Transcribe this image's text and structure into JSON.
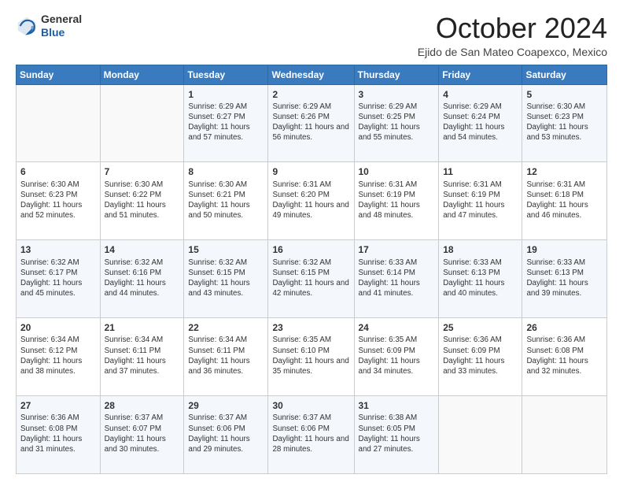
{
  "header": {
    "logo": {
      "line1": "General",
      "line2": "Blue"
    },
    "title": "October 2024",
    "location": "Ejido de San Mateo Coapexco, Mexico"
  },
  "weekdays": [
    "Sunday",
    "Monday",
    "Tuesday",
    "Wednesday",
    "Thursday",
    "Friday",
    "Saturday"
  ],
  "weeks": [
    [
      {
        "day": "",
        "sunrise": "",
        "sunset": "",
        "daylight": ""
      },
      {
        "day": "",
        "sunrise": "",
        "sunset": "",
        "daylight": ""
      },
      {
        "day": "1",
        "sunrise": "Sunrise: 6:29 AM",
        "sunset": "Sunset: 6:27 PM",
        "daylight": "Daylight: 11 hours and 57 minutes."
      },
      {
        "day": "2",
        "sunrise": "Sunrise: 6:29 AM",
        "sunset": "Sunset: 6:26 PM",
        "daylight": "Daylight: 11 hours and 56 minutes."
      },
      {
        "day": "3",
        "sunrise": "Sunrise: 6:29 AM",
        "sunset": "Sunset: 6:25 PM",
        "daylight": "Daylight: 11 hours and 55 minutes."
      },
      {
        "day": "4",
        "sunrise": "Sunrise: 6:29 AM",
        "sunset": "Sunset: 6:24 PM",
        "daylight": "Daylight: 11 hours and 54 minutes."
      },
      {
        "day": "5",
        "sunrise": "Sunrise: 6:30 AM",
        "sunset": "Sunset: 6:23 PM",
        "daylight": "Daylight: 11 hours and 53 minutes."
      }
    ],
    [
      {
        "day": "6",
        "sunrise": "Sunrise: 6:30 AM",
        "sunset": "Sunset: 6:23 PM",
        "daylight": "Daylight: 11 hours and 52 minutes."
      },
      {
        "day": "7",
        "sunrise": "Sunrise: 6:30 AM",
        "sunset": "Sunset: 6:22 PM",
        "daylight": "Daylight: 11 hours and 51 minutes."
      },
      {
        "day": "8",
        "sunrise": "Sunrise: 6:30 AM",
        "sunset": "Sunset: 6:21 PM",
        "daylight": "Daylight: 11 hours and 50 minutes."
      },
      {
        "day": "9",
        "sunrise": "Sunrise: 6:31 AM",
        "sunset": "Sunset: 6:20 PM",
        "daylight": "Daylight: 11 hours and 49 minutes."
      },
      {
        "day": "10",
        "sunrise": "Sunrise: 6:31 AM",
        "sunset": "Sunset: 6:19 PM",
        "daylight": "Daylight: 11 hours and 48 minutes."
      },
      {
        "day": "11",
        "sunrise": "Sunrise: 6:31 AM",
        "sunset": "Sunset: 6:19 PM",
        "daylight": "Daylight: 11 hours and 47 minutes."
      },
      {
        "day": "12",
        "sunrise": "Sunrise: 6:31 AM",
        "sunset": "Sunset: 6:18 PM",
        "daylight": "Daylight: 11 hours and 46 minutes."
      }
    ],
    [
      {
        "day": "13",
        "sunrise": "Sunrise: 6:32 AM",
        "sunset": "Sunset: 6:17 PM",
        "daylight": "Daylight: 11 hours and 45 minutes."
      },
      {
        "day": "14",
        "sunrise": "Sunrise: 6:32 AM",
        "sunset": "Sunset: 6:16 PM",
        "daylight": "Daylight: 11 hours and 44 minutes."
      },
      {
        "day": "15",
        "sunrise": "Sunrise: 6:32 AM",
        "sunset": "Sunset: 6:15 PM",
        "daylight": "Daylight: 11 hours and 43 minutes."
      },
      {
        "day": "16",
        "sunrise": "Sunrise: 6:32 AM",
        "sunset": "Sunset: 6:15 PM",
        "daylight": "Daylight: 11 hours and 42 minutes."
      },
      {
        "day": "17",
        "sunrise": "Sunrise: 6:33 AM",
        "sunset": "Sunset: 6:14 PM",
        "daylight": "Daylight: 11 hours and 41 minutes."
      },
      {
        "day": "18",
        "sunrise": "Sunrise: 6:33 AM",
        "sunset": "Sunset: 6:13 PM",
        "daylight": "Daylight: 11 hours and 40 minutes."
      },
      {
        "day": "19",
        "sunrise": "Sunrise: 6:33 AM",
        "sunset": "Sunset: 6:13 PM",
        "daylight": "Daylight: 11 hours and 39 minutes."
      }
    ],
    [
      {
        "day": "20",
        "sunrise": "Sunrise: 6:34 AM",
        "sunset": "Sunset: 6:12 PM",
        "daylight": "Daylight: 11 hours and 38 minutes."
      },
      {
        "day": "21",
        "sunrise": "Sunrise: 6:34 AM",
        "sunset": "Sunset: 6:11 PM",
        "daylight": "Daylight: 11 hours and 37 minutes."
      },
      {
        "day": "22",
        "sunrise": "Sunrise: 6:34 AM",
        "sunset": "Sunset: 6:11 PM",
        "daylight": "Daylight: 11 hours and 36 minutes."
      },
      {
        "day": "23",
        "sunrise": "Sunrise: 6:35 AM",
        "sunset": "Sunset: 6:10 PM",
        "daylight": "Daylight: 11 hours and 35 minutes."
      },
      {
        "day": "24",
        "sunrise": "Sunrise: 6:35 AM",
        "sunset": "Sunset: 6:09 PM",
        "daylight": "Daylight: 11 hours and 34 minutes."
      },
      {
        "day": "25",
        "sunrise": "Sunrise: 6:36 AM",
        "sunset": "Sunset: 6:09 PM",
        "daylight": "Daylight: 11 hours and 33 minutes."
      },
      {
        "day": "26",
        "sunrise": "Sunrise: 6:36 AM",
        "sunset": "Sunset: 6:08 PM",
        "daylight": "Daylight: 11 hours and 32 minutes."
      }
    ],
    [
      {
        "day": "27",
        "sunrise": "Sunrise: 6:36 AM",
        "sunset": "Sunset: 6:08 PM",
        "daylight": "Daylight: 11 hours and 31 minutes."
      },
      {
        "day": "28",
        "sunrise": "Sunrise: 6:37 AM",
        "sunset": "Sunset: 6:07 PM",
        "daylight": "Daylight: 11 hours and 30 minutes."
      },
      {
        "day": "29",
        "sunrise": "Sunrise: 6:37 AM",
        "sunset": "Sunset: 6:06 PM",
        "daylight": "Daylight: 11 hours and 29 minutes."
      },
      {
        "day": "30",
        "sunrise": "Sunrise: 6:37 AM",
        "sunset": "Sunset: 6:06 PM",
        "daylight": "Daylight: 11 hours and 28 minutes."
      },
      {
        "day": "31",
        "sunrise": "Sunrise: 6:38 AM",
        "sunset": "Sunset: 6:05 PM",
        "daylight": "Daylight: 11 hours and 27 minutes."
      },
      {
        "day": "",
        "sunrise": "",
        "sunset": "",
        "daylight": ""
      },
      {
        "day": "",
        "sunrise": "",
        "sunset": "",
        "daylight": ""
      }
    ]
  ]
}
